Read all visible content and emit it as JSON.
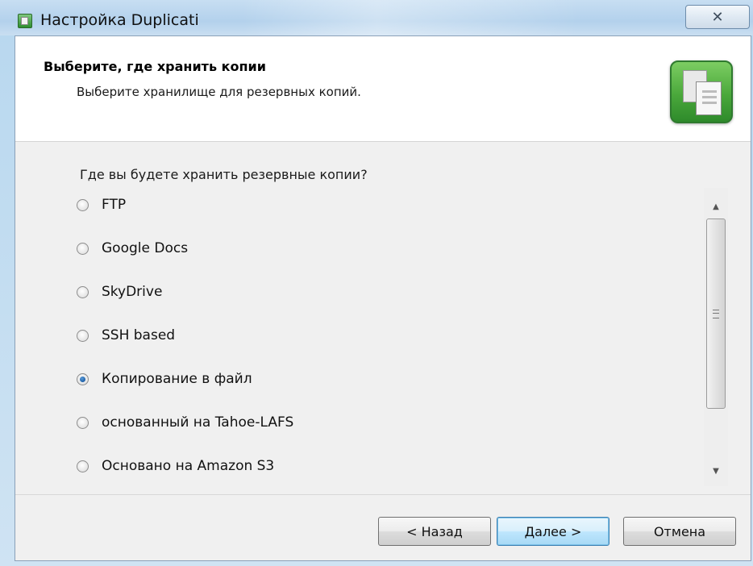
{
  "window": {
    "title": "Настройка Duplicati",
    "close_label": "☒"
  },
  "header": {
    "title": "Выберите, где хранить копии",
    "subtitle": "Выберите хранилище для резервных копий."
  },
  "question": "Где вы будете хранить резервные копии?",
  "options": [
    {
      "label": "FTP",
      "selected": false
    },
    {
      "label": "Google Docs",
      "selected": false
    },
    {
      "label": "SkyDrive",
      "selected": false
    },
    {
      "label": "SSH based",
      "selected": false
    },
    {
      "label": "Копирование в файл",
      "selected": true
    },
    {
      "label": "основанный на Tahoe-LAFS",
      "selected": false
    },
    {
      "label": "Основано на Amazon S3",
      "selected": false
    }
  ],
  "scrollbar": {
    "up_icon": "▲",
    "down_icon": "▼"
  },
  "buttons": {
    "back": "< Назад",
    "next": "Далее >",
    "cancel": "Отмена"
  },
  "colors": {
    "accent": "#3c7fb1",
    "icon_green": "#4aa83b"
  }
}
